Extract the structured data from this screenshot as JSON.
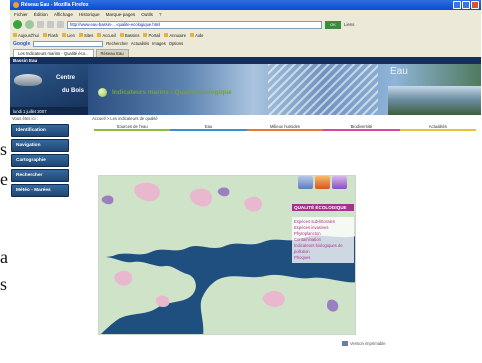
{
  "browser": {
    "title": "Réseau Eau - Mozilla Firefox",
    "menu": [
      "Fichier",
      "Édition",
      "Affichage",
      "Historique",
      "Marque-pages",
      "Outils",
      "?"
    ],
    "address": "http://www.eau-bassin-...-qualite-ecologique.html",
    "go_label": "OK",
    "links_label": "Liens",
    "bookmarks": [
      "Aujourd'hui",
      "Flash",
      "Lien",
      "Sites",
      "Accueil",
      "Bassins",
      "Portail",
      "Annuaire",
      "Aide"
    ],
    "google": {
      "logo": "Google",
      "search_label": "Rechercher",
      "tools": [
        "Actualités",
        "Images",
        "Options"
      ]
    },
    "tabs": [
      {
        "label": "Les Indicateurs marins - Qualité éco..."
      },
      {
        "label": "Réseau Eau"
      }
    ]
  },
  "site": {
    "logo_strip": "Bassin Eau",
    "logo_title1": "Centre",
    "logo_title2": "du Bois",
    "date": "lundi 1 juillet 2007",
    "banner_word": "Eau",
    "left_label": "Vous êtes ici :",
    "nav": [
      "Identification",
      "Navigation",
      "Cartographie",
      "Rechercher",
      "Météo - Marées"
    ],
    "breadcrumb": "Accueil > Les indicateurs de qualité",
    "section_tabs": [
      "Sources de l'eau",
      "Eau",
      "Milieux humides",
      "Biodiversité",
      "Actualités"
    ],
    "page_title": "Indicateurs marins - Qualité écologique",
    "legend_title": "QUALITÉ ÉCOLOGIQUE",
    "legend_items": [
      "Espèces sub-littorales",
      "Espèces invasives",
      "Phytoplancton",
      "Contamination",
      "Indicateurs biologiques de pollution",
      "Phoques"
    ],
    "footer_link": "Version imprimable"
  },
  "document_fragments": [
    "s",
    "e",
    "a",
    "s"
  ]
}
